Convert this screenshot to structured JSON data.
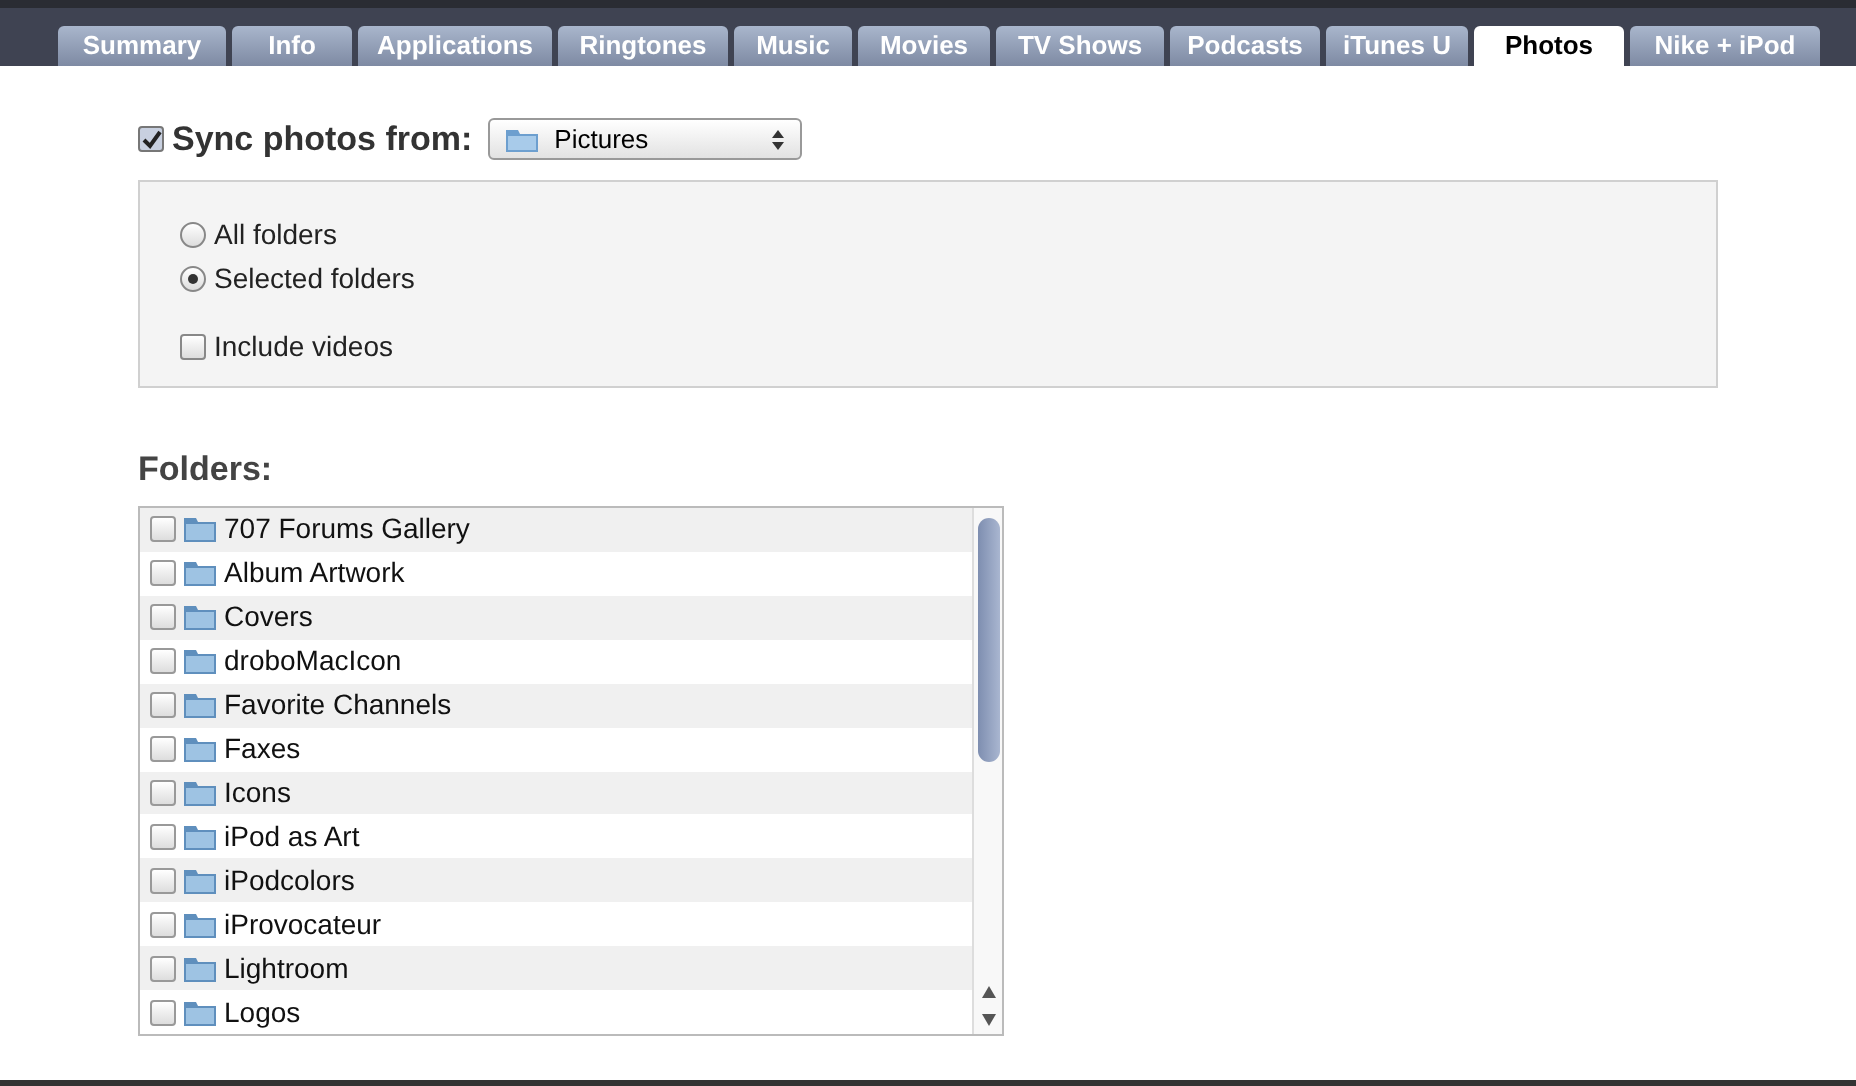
{
  "tabs": [
    {
      "label": "Summary",
      "selected": false
    },
    {
      "label": "Info",
      "selected": false
    },
    {
      "label": "Applications",
      "selected": false
    },
    {
      "label": "Ringtones",
      "selected": false
    },
    {
      "label": "Music",
      "selected": false
    },
    {
      "label": "Movies",
      "selected": false
    },
    {
      "label": "TV Shows",
      "selected": false
    },
    {
      "label": "Podcasts",
      "selected": false
    },
    {
      "label": "iTunes U",
      "selected": false
    },
    {
      "label": "Photos",
      "selected": true
    },
    {
      "label": "Nike + iPod",
      "selected": false
    }
  ],
  "sync": {
    "label": "Sync photos from:",
    "checked": true,
    "source": "Pictures"
  },
  "options": [
    {
      "kind": "radio",
      "label": "All folders",
      "selected": false
    },
    {
      "kind": "radio",
      "label": "Selected folders",
      "selected": true
    },
    {
      "kind": "checkbox",
      "label": "Include videos",
      "checked": false
    }
  ],
  "folders_heading": "Folders:",
  "folders": [
    {
      "name": "707 Forums Gallery",
      "checked": false
    },
    {
      "name": "Album Artwork",
      "checked": false
    },
    {
      "name": "Covers",
      "checked": false
    },
    {
      "name": "droboMacIcon",
      "checked": false
    },
    {
      "name": "Favorite Channels",
      "checked": false
    },
    {
      "name": "Faxes",
      "checked": false
    },
    {
      "name": "Icons",
      "checked": false
    },
    {
      "name": "iPod as Art",
      "checked": false
    },
    {
      "name": "iPodcolors",
      "checked": false
    },
    {
      "name": "iProvocateur",
      "checked": false
    },
    {
      "name": "Lightroom",
      "checked": false
    },
    {
      "name": "Logos",
      "checked": false
    }
  ]
}
